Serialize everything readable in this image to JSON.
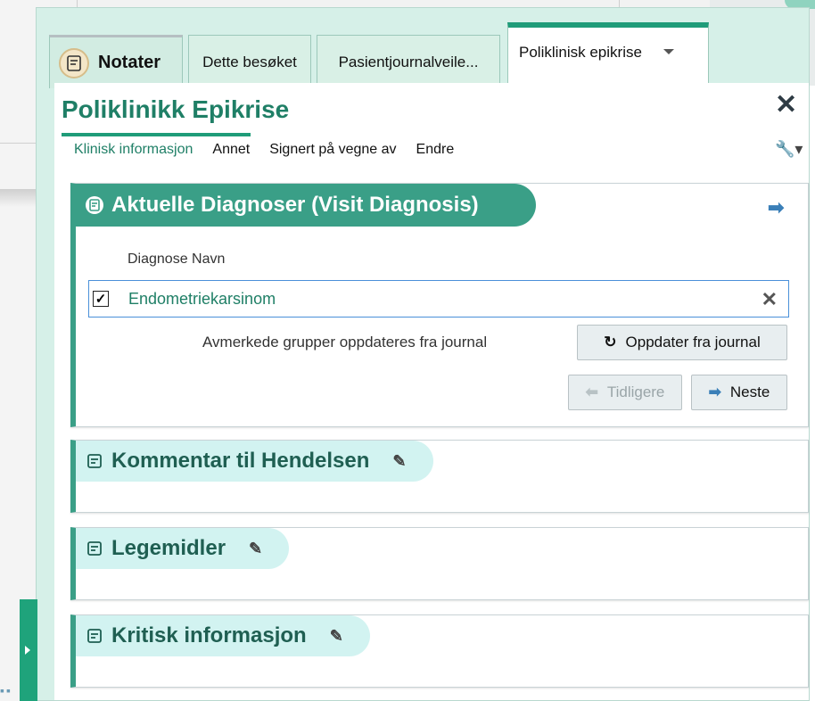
{
  "tabs": [
    {
      "label": "Notater",
      "icon": "note-icon"
    },
    {
      "label": "Dette besøket"
    },
    {
      "label": "Pasientjournalveile..."
    },
    {
      "label": "Poliklinisk epikrise",
      "active": true
    }
  ],
  "panel": {
    "title": "Poliklinikk Epikrise",
    "menu": [
      "Klinisk informasjon",
      "Annet",
      "Signert på vegne av",
      "Endre"
    ]
  },
  "diagnoses": {
    "header": "Aktuelle Diagnoser (Visit Diagnosis)",
    "column_label": "Diagnose Navn",
    "items": [
      {
        "name": "Endometriekarsinom",
        "checked": true
      }
    ],
    "note": "Avmerkede grupper oppdateres fra journal",
    "update_button": "Oppdater fra journal",
    "prev_button": "Tidligere",
    "next_button": "Neste"
  },
  "sections": [
    {
      "title": "Kommentar til Hendelsen"
    },
    {
      "title": "Legemidler"
    },
    {
      "title": "Kritisk informasjon"
    }
  ],
  "colors": {
    "accent": "#1f9c79",
    "section_header": "#3a9f87",
    "section_header_light": "#d2f3f1",
    "link_blue": "#3a7fb8"
  }
}
